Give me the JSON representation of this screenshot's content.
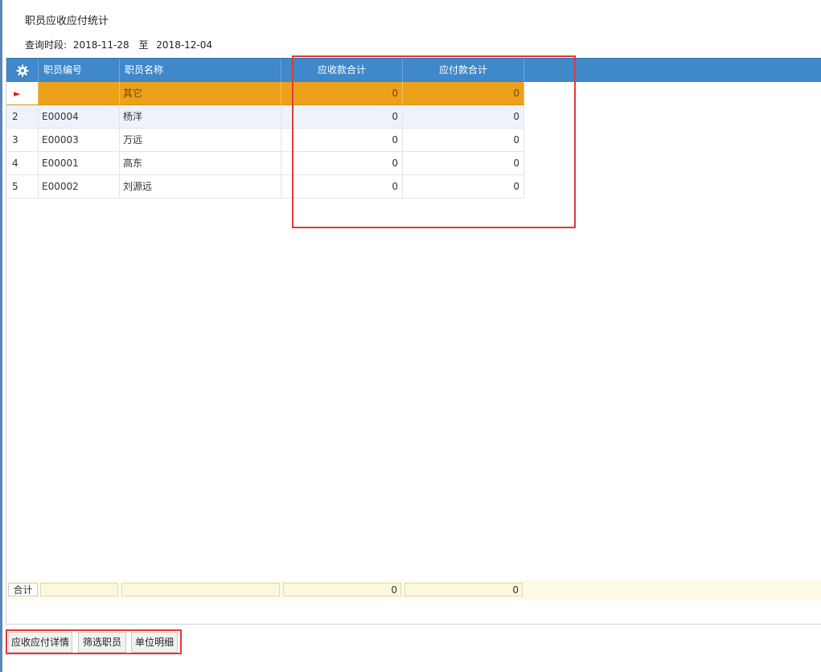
{
  "page": {
    "title": "职员应收应付统计",
    "query_label": "查询时段:",
    "date_from": "2018-11-28",
    "date_sep": "至",
    "date_to": "2018-12-04"
  },
  "grid": {
    "settings_icon": "gear-icon",
    "columns": [
      "职员编号",
      "职员名称",
      "应收款合计",
      "应付款合计"
    ],
    "rows": [
      {
        "num": "",
        "indicator": "►",
        "code": "",
        "name": "其它",
        "receivable": "0",
        "payable": "0"
      },
      {
        "num": "2",
        "code": "E00004",
        "name": "杨洋",
        "receivable": "0",
        "payable": "0"
      },
      {
        "num": "3",
        "code": "E00003",
        "name": "万远",
        "receivable": "0",
        "payable": "0"
      },
      {
        "num": "4",
        "code": "E00001",
        "name": "高东",
        "receivable": "0",
        "payable": "0"
      },
      {
        "num": "5",
        "code": "E00002",
        "name": "刘源远",
        "receivable": "0",
        "payable": "0"
      }
    ],
    "footer": {
      "label": "合计",
      "receivable": "0",
      "payable": "0"
    }
  },
  "buttons": [
    "应收应付详情",
    "筛选职员",
    "单位明细"
  ],
  "colors": {
    "header": "#3f88c9",
    "selected_row": "#eda01a",
    "highlight_box": "#e03a3a"
  }
}
